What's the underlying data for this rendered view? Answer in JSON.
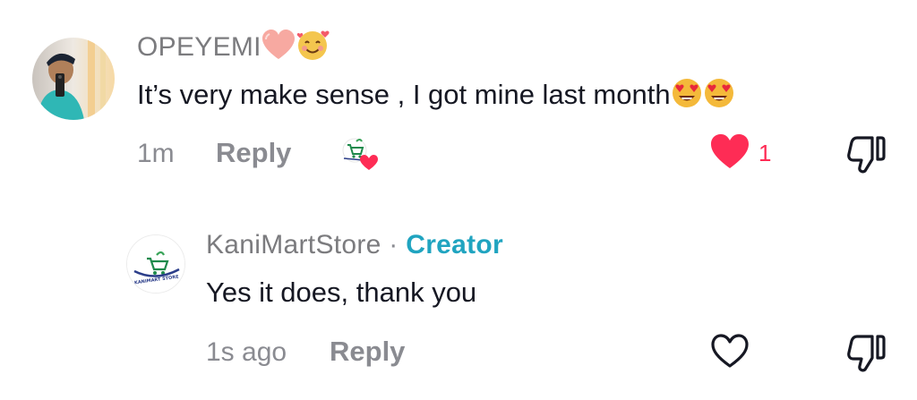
{
  "comments": [
    {
      "username": "OPEYEMI",
      "username_emojis": [
        "heart-emoji",
        "smiling-face-with-hearts-emoji"
      ],
      "text": "It’s very make sense , I got mine last month",
      "text_emojis": [
        "heart-eyes-emoji",
        "heart-eyes-emoji"
      ],
      "time": "1m",
      "reply_label": "Reply",
      "creator_liked_icon": "creator-liked-icon",
      "like_icon": "heart-filled-icon",
      "like_count": "1",
      "dislike_icon": "thumbs-down-icon"
    },
    {
      "username": "KaniMartStore",
      "separator": "·",
      "badge": "Creator",
      "text": "Yes it does, thank you",
      "time": "1s ago",
      "reply_label": "Reply",
      "like_icon": "heart-outline-icon",
      "dislike_icon": "thumbs-down-icon",
      "avatar_logo_text": "KANIMART STORE"
    }
  ],
  "colors": {
    "like_red": "#fe2c55",
    "creator_teal": "#20a4c0",
    "meta_gray": "#8a8b91",
    "text": "#161823"
  }
}
